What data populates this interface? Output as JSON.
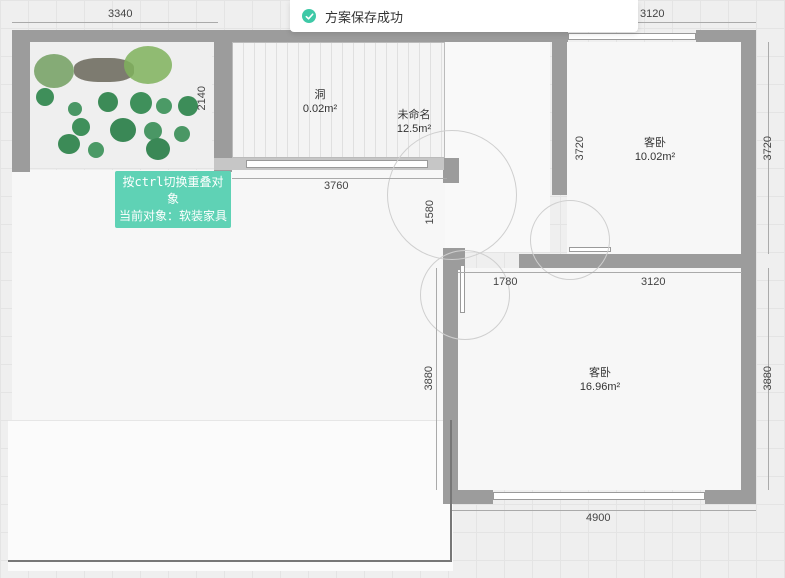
{
  "toast": {
    "text": "方案保存成功",
    "icon": "check-circle-icon",
    "color": "#3ec9a7"
  },
  "tooltip": {
    "line1": "按ctrl切换重叠对象",
    "line2": "当前对象：软装家具"
  },
  "rooms": {
    "hole": {
      "name": "洞",
      "area": "0.02m²"
    },
    "unnamed": {
      "name": "未命名",
      "area": "12.5m²"
    },
    "bedroom_top": {
      "name": "客卧",
      "area": "10.02m²"
    },
    "bedroom_bottom": {
      "name": "客卧",
      "area": "16.96m²"
    }
  },
  "dimensions": {
    "top_left": "3340",
    "top_right": "3120",
    "left_garden": "2140",
    "mid_horizontal": "3760",
    "door_vertical": "1580",
    "bedroom_top_inner_v": "3720",
    "right_top_v": "3720",
    "mid_left_h": "1780",
    "mid_right_h": "3120",
    "bedroom_bottom_inner_v": "3880",
    "right_bottom_v": "3880",
    "bottom_h": "4900"
  },
  "colors": {
    "wall": "#9c9c9c",
    "accent": "#5fd2b5",
    "floor": "#f7f7f7"
  }
}
